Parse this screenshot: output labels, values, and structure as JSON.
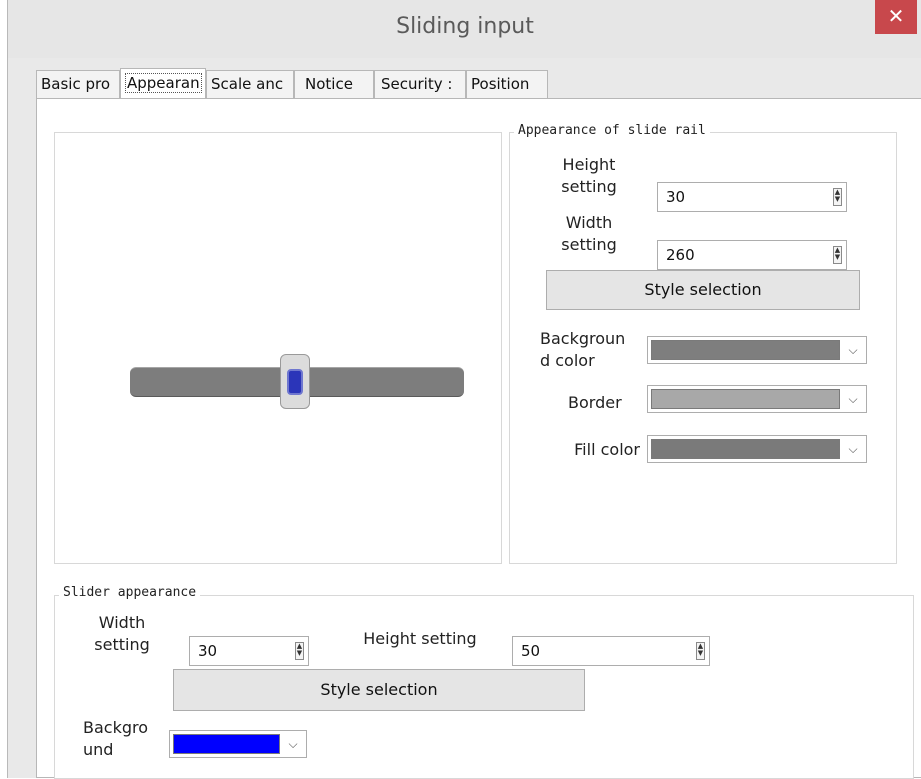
{
  "window": {
    "title": "Sliding input",
    "close_glyph": "✕"
  },
  "tabs": [
    {
      "label": "Basic pro"
    },
    {
      "label": "Appearan"
    },
    {
      "label": "Scale anc"
    },
    {
      "label": "Notice"
    },
    {
      "label": "Security :"
    },
    {
      "label": "Position"
    }
  ],
  "active_tab": "Appearan",
  "rail": {
    "group_title": "Appearance of slide rail",
    "height_label": "Height setting",
    "height_value": "30",
    "width_label": "Width setting",
    "width_value": "260",
    "style_button": "Style selection",
    "background_label": "Backgroun d color",
    "background_color": "#7e7e7e",
    "border_label": "Border",
    "border_color": "#a8a8a8",
    "fill_label": "Fill color",
    "fill_color": "#7a7a7a"
  },
  "slider": {
    "group_title": "Slider appearance",
    "width_label": "Width setting",
    "width_value": "30",
    "height_label": "Height setting",
    "height_value": "50",
    "style_button": "Style selection",
    "background_label": "Backgro und",
    "background_color": "#0000ff"
  },
  "preview": {
    "rail_color": "#7d7d7d",
    "knob_color": "#2b35b9"
  },
  "icons": {
    "close": "close-icon",
    "spin": "spin-arrows-icon",
    "dropdown": "chevron-down-icon"
  }
}
